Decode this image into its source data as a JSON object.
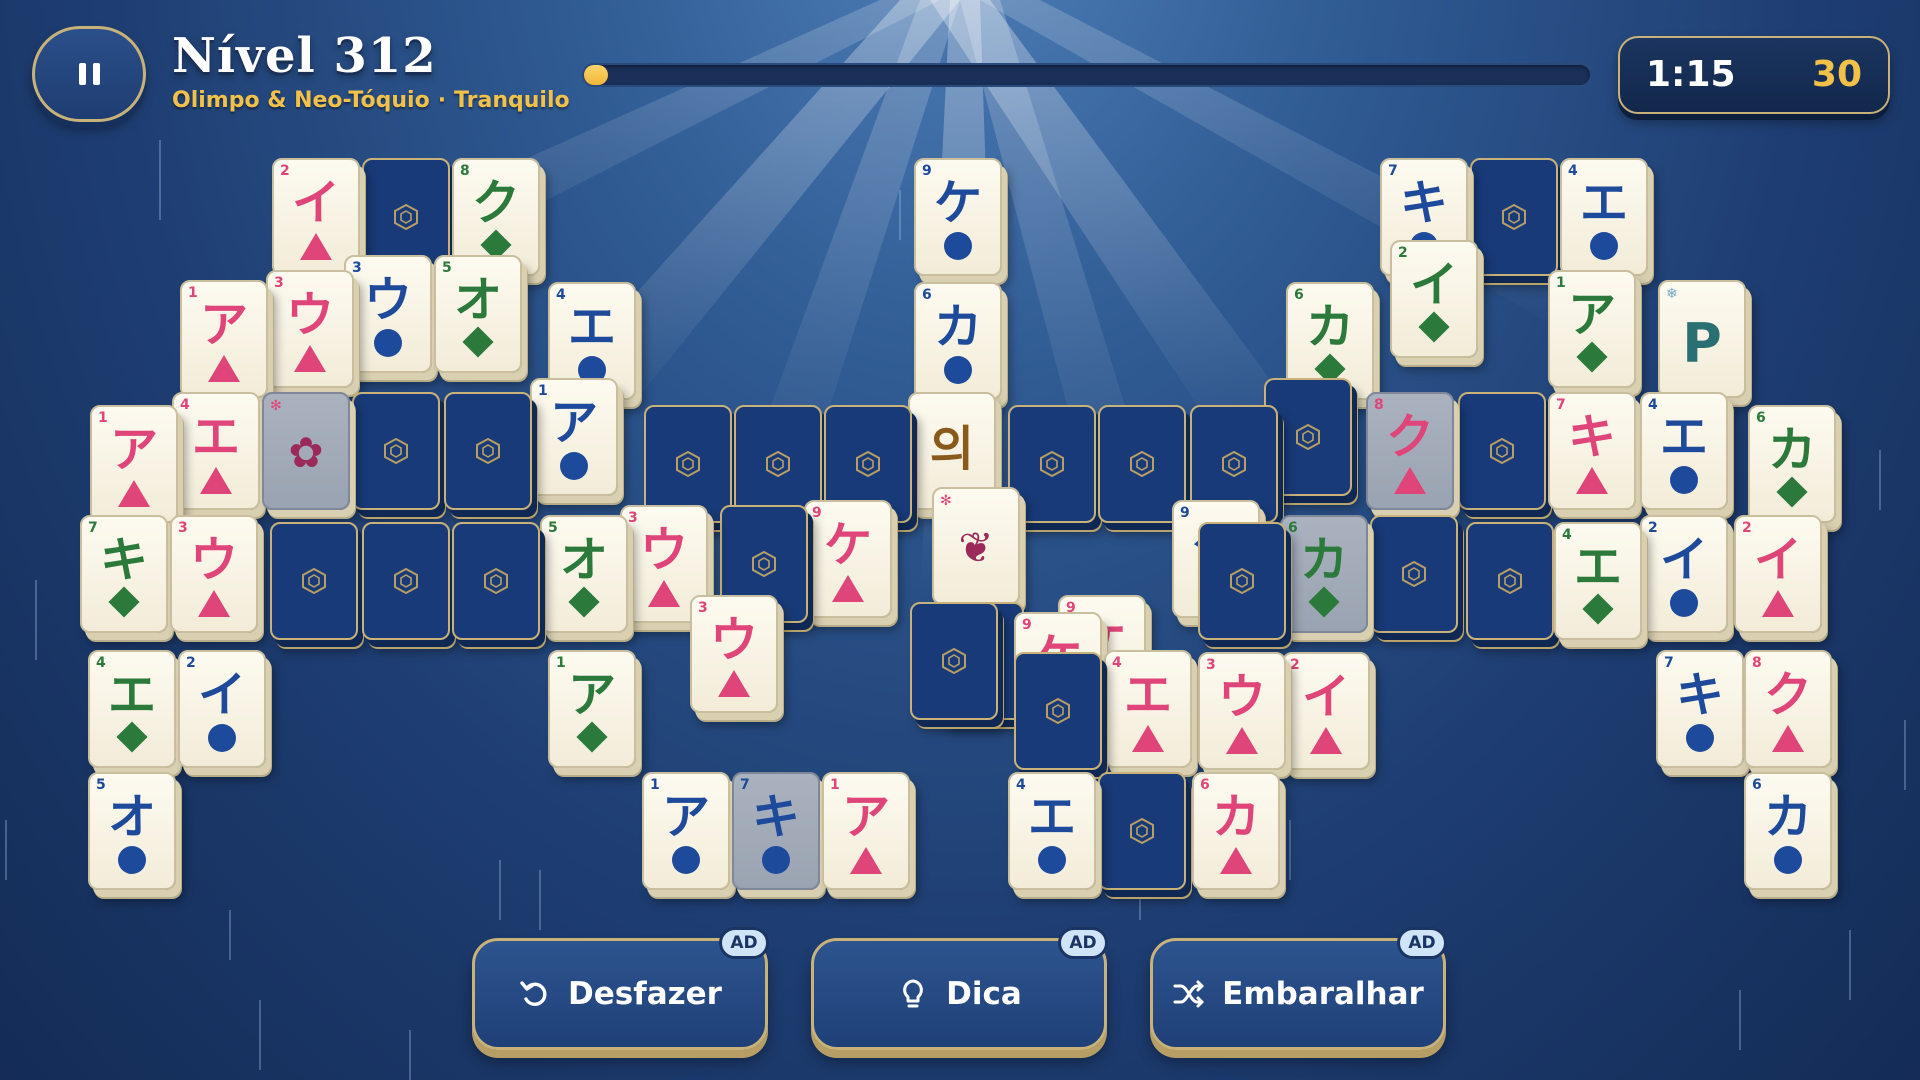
{
  "hud": {
    "level_title": "Nível 312",
    "subtitle_world": "Olimpo & Neo-Tóquio",
    "subtitle_separator": "·",
    "subtitle_mode": "Tranquilo",
    "progress_fraction": 0.02,
    "timer": "1:15",
    "moves": "30"
  },
  "colors": {
    "pink": "#e0457a",
    "blue": "#1e4a9b",
    "green": "#2c7a3b",
    "gold": "#f2c14a",
    "tile_back": "#183a78"
  },
  "actions": {
    "undo_label": "Desfazer",
    "hint_label": "Dica",
    "shuffle_label": "Embaralhar",
    "ad_badge": "AD"
  },
  "tiles": [
    {
      "t": "face",
      "n": "2",
      "g": "イ",
      "s": "tri",
      "c": "pink"
    },
    {
      "t": "back"
    },
    {
      "t": "face",
      "n": "8",
      "g": "ク",
      "s": "diamond",
      "c": "green"
    },
    {
      "t": "face",
      "n": "1",
      "g": "ア",
      "s": "tri",
      "c": "pink"
    },
    {
      "t": "face",
      "n": "3",
      "g": "ウ",
      "s": "tri",
      "c": "pink"
    },
    {
      "t": "face",
      "n": "3",
      "g": "ウ",
      "s": "circle",
      "c": "blue"
    },
    {
      "t": "face",
      "n": "5",
      "g": "オ",
      "s": "diamond",
      "c": "green"
    },
    {
      "t": "face",
      "n": "4",
      "g": "エ",
      "s": "circle",
      "c": "blue"
    },
    {
      "t": "face",
      "n": "1",
      "g": "ア",
      "s": "tri",
      "c": "pink"
    },
    {
      "t": "face",
      "n": "4",
      "g": "エ",
      "s": "tri",
      "c": "pink"
    },
    {
      "t": "flower",
      "dim": true,
      "g": "✿"
    },
    {
      "t": "back"
    },
    {
      "t": "back"
    },
    {
      "t": "face",
      "n": "1",
      "g": "ア",
      "s": "circle",
      "c": "blue"
    },
    {
      "t": "face",
      "n": "7",
      "g": "キ",
      "s": "diamond",
      "c": "green"
    },
    {
      "t": "face",
      "n": "3",
      "g": "ウ",
      "s": "tri",
      "c": "pink"
    },
    {
      "t": "back"
    },
    {
      "t": "back"
    },
    {
      "t": "back"
    },
    {
      "t": "face",
      "n": "5",
      "g": "オ",
      "s": "diamond",
      "c": "green"
    },
    {
      "t": "face",
      "n": "4",
      "g": "エ",
      "s": "diamond",
      "c": "green"
    },
    {
      "t": "face",
      "n": "2",
      "g": "イ",
      "s": "circle",
      "c": "blue"
    },
    {
      "t": "face",
      "n": "1",
      "g": "ア",
      "s": "diamond",
      "c": "green"
    },
    {
      "t": "face",
      "n": "5",
      "g": "オ",
      "s": "circle",
      "c": "blue"
    },
    {
      "t": "face",
      "n": "9",
      "g": "ケ",
      "s": "circle",
      "c": "blue"
    },
    {
      "t": "face",
      "n": "6",
      "g": "カ",
      "s": "circle",
      "c": "blue"
    },
    {
      "t": "back"
    },
    {
      "t": "back"
    },
    {
      "t": "back"
    },
    {
      "t": "face",
      "n": "",
      "g": "의",
      "s": "none",
      "c": "gold"
    },
    {
      "t": "back"
    },
    {
      "t": "back"
    },
    {
      "t": "back"
    },
    {
      "t": "face",
      "n": "3",
      "g": "ウ",
      "s": "tri",
      "c": "pink"
    },
    {
      "t": "back"
    },
    {
      "t": "face",
      "n": "9",
      "g": "ケ",
      "s": "tri",
      "c": "pink"
    },
    {
      "t": "face",
      "n": "3",
      "g": "ウ",
      "s": "tri",
      "c": "pink"
    },
    {
      "t": "flower",
      "g": "❦"
    },
    {
      "t": "face",
      "n": "9",
      "g": "ケ",
      "s": "tri",
      "c": "pink"
    },
    {
      "t": "back"
    },
    {
      "t": "face",
      "n": "9",
      "g": "ケ",
      "s": "circle",
      "c": "blue"
    },
    {
      "t": "face",
      "n": "1",
      "g": "ア",
      "s": "circle",
      "c": "blue"
    },
    {
      "t": "face",
      "n": "7",
      "g": "キ",
      "s": "circle",
      "c": "blue",
      "dim": true
    },
    {
      "t": "face",
      "n": "1",
      "g": "ア",
      "s": "tri",
      "c": "pink"
    },
    {
      "t": "face",
      "n": "4",
      "g": "エ",
      "s": "circle",
      "c": "blue"
    },
    {
      "t": "back"
    },
    {
      "t": "face",
      "n": "6",
      "g": "カ",
      "s": "tri",
      "c": "pink"
    },
    {
      "t": "face",
      "n": "2",
      "g": "イ",
      "s": "tri",
      "c": "pink"
    },
    {
      "t": "back"
    },
    {
      "t": "face",
      "n": "4",
      "g": "エ",
      "s": "circle",
      "c": "blue"
    },
    {
      "t": "face",
      "n": "7",
      "g": "キ",
      "s": "circle",
      "c": "blue"
    },
    {
      "t": "face",
      "n": "6",
      "g": "カ",
      "s": "diamond",
      "c": "green"
    },
    {
      "t": "face",
      "n": "2",
      "g": "イ",
      "s": "diamond",
      "c": "green"
    },
    {
      "t": "face",
      "n": "1",
      "g": "ア",
      "s": "diamond",
      "c": "green"
    },
    {
      "t": "season",
      "g": "P"
    },
    {
      "t": "back"
    },
    {
      "t": "face",
      "n": "8",
      "g": "ク",
      "s": "tri",
      "c": "pink",
      "dim": true
    },
    {
      "t": "back"
    },
    {
      "t": "face",
      "n": "7",
      "g": "キ",
      "s": "tri",
      "c": "pink"
    },
    {
      "t": "face",
      "n": "4",
      "g": "エ",
      "s": "circle",
      "c": "blue"
    },
    {
      "t": "face",
      "n": "6",
      "g": "カ",
      "s": "diamond",
      "c": "green"
    },
    {
      "t": "face",
      "n": "6",
      "g": "カ",
      "s": "diamond",
      "c": "green",
      "dim": true
    },
    {
      "t": "back"
    },
    {
      "t": "back"
    },
    {
      "t": "face",
      "n": "4",
      "g": "エ",
      "s": "diamond",
      "c": "green"
    },
    {
      "t": "face",
      "n": "2",
      "g": "イ",
      "s": "circle",
      "c": "blue"
    },
    {
      "t": "face",
      "n": "2",
      "g": "イ",
      "s": "tri",
      "c": "pink"
    },
    {
      "t": "face",
      "n": "7",
      "g": "キ",
      "s": "circle",
      "c": "blue"
    },
    {
      "t": "face",
      "n": "8",
      "g": "ク",
      "s": "tri",
      "c": "pink"
    },
    {
      "t": "face",
      "n": "6",
      "g": "カ",
      "s": "circle",
      "c": "blue"
    },
    {
      "t": "back"
    },
    {
      "t": "face",
      "n": "4",
      "g": "エ",
      "s": "tri",
      "c": "pink"
    },
    {
      "t": "back"
    },
    {
      "t": "face",
      "n": "3",
      "g": "ウ",
      "s": "tri",
      "c": "pink"
    },
    {
      "t": "back"
    },
    {
      "t": "face",
      "n": "9",
      "g": "ケ",
      "s": "tri",
      "c": "pink"
    }
  ]
}
